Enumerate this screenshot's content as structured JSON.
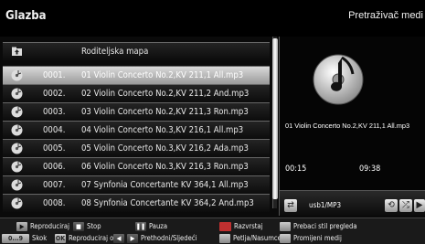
{
  "header": {
    "title": "Glazba",
    "subtitle": "Pretraživač medi"
  },
  "list": {
    "parent_folder": "Roditeljska mapa",
    "items": [
      {
        "num": "0001.",
        "name": "01 Violin Concerto No.2,KV 211,1 All.mp3",
        "selected": true
      },
      {
        "num": "0002.",
        "name": "02 Violin Concerto No.2,KV 211,2 And.mp3"
      },
      {
        "num": "0003.",
        "name": "03 Violin Concerto No.2,KV 211,3 Ron.mp3"
      },
      {
        "num": "0004.",
        "name": "04 Violin Concerto No.3,KV 216,1 All.mp3"
      },
      {
        "num": "0005.",
        "name": "05 Violin Concerto No.3,KV 216,2 Ada.mp3"
      },
      {
        "num": "0006.",
        "name": "06 Violin Concerto No.3,KV 216,3 Ron.mp3"
      },
      {
        "num": "0007.",
        "name": "07 Synfonia Concertante KV 364,1 All.mp3"
      },
      {
        "num": "0008.",
        "name": "08 Synfonia Concertante KV 364,2 And.mp3"
      }
    ]
  },
  "preview": {
    "now_playing": "01 Violin Concerto No.2,KV 211,1 All.mp3",
    "elapsed": "00:15",
    "total": "09:38",
    "source": "usb1/MP3"
  },
  "footer": {
    "play": "Reproduciraj",
    "stop": "Stop",
    "pause": "Pauza",
    "sort": "Razvrstaj",
    "view_style": "Prebaci stil pregleda",
    "skip_key": "0...9",
    "skip": "Skok",
    "ok_key": "OK",
    "play_this": "Reproduciraj ovo",
    "prev_next": "Prethodni/Sljedeći",
    "loop_shuffle": "Petlja/Nasumce",
    "change_media": "Promijeni medij"
  },
  "colors": {
    "selected_row": "#bdbdbd",
    "background": "#0a0a0a",
    "key_red": "#c03030"
  }
}
